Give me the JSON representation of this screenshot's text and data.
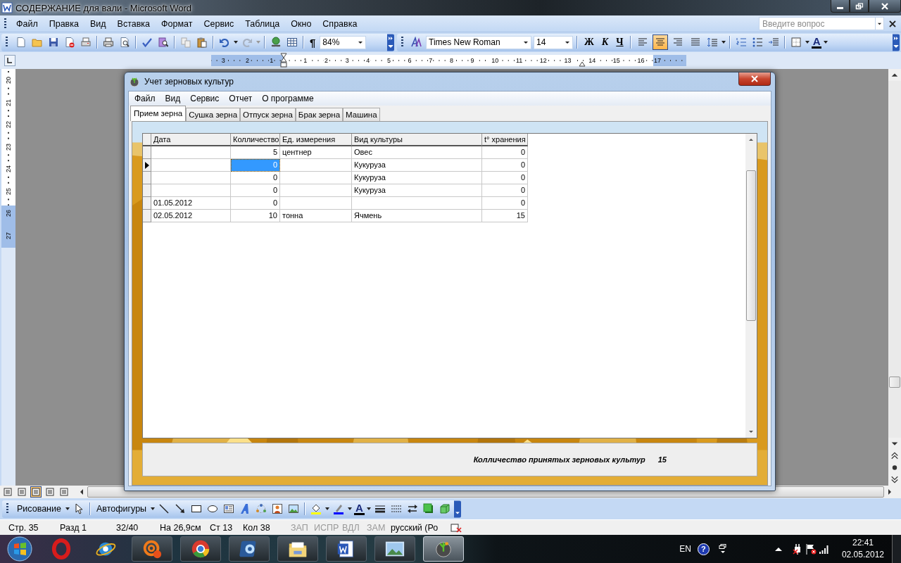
{
  "window": {
    "title": "СОДЕРЖАНИЕ для вали - Microsoft Word"
  },
  "menu": [
    "Файл",
    "Правка",
    "Вид",
    "Вставка",
    "Формат",
    "Сервис",
    "Таблица",
    "Окно",
    "Справка"
  ],
  "help_box": {
    "placeholder": "Введите вопрос"
  },
  "toolbar": {
    "show_marks": "¶",
    "zoom": "84%",
    "font": "Times New Roman",
    "size": "14",
    "bold": "Ж",
    "italic": "К",
    "underline": "Ч",
    "alignment": [
      {
        "selected": false
      },
      {
        "selected": true
      },
      {
        "selected": false
      },
      {
        "selected": false
      }
    ],
    "font_color": "A"
  },
  "ruler": {
    "left_labels": [
      "3",
      "2",
      "1"
    ],
    "labels": [
      "1",
      "2",
      "3",
      "4",
      "5",
      "6",
      "7",
      "8",
      "9",
      "10",
      "11",
      "12",
      "13",
      "14",
      "15",
      "16"
    ],
    "right_labels": [
      "17"
    ]
  },
  "vertical_ruler": [
    "20",
    "21",
    "22",
    "23",
    "24",
    "25",
    "26",
    "27"
  ],
  "dialog": {
    "title": "Учет зерновых культур",
    "menu": [
      "Файл",
      "Вид",
      "Сервис",
      "Отчет",
      "О программе"
    ],
    "tabs": [
      {
        "label": "Прием зерна",
        "selected": true
      },
      {
        "label": "Сушка зерна",
        "selected": false
      },
      {
        "label": "Отпуск зерна",
        "selected": false
      },
      {
        "label": "Брак зерна",
        "selected": false
      },
      {
        "label": "Машина",
        "selected": false
      }
    ],
    "grid": {
      "columns": [
        "Дата",
        "Колличество",
        "Ед. измерения",
        "Вид культуры",
        "t° хранения"
      ],
      "rows": [
        {
          "selected": false,
          "cells": [
            "",
            "5",
            "центнер",
            "Овес",
            "0"
          ]
        },
        {
          "selected": true,
          "cells": [
            "",
            "0",
            "",
            "Кукуруза",
            "0"
          ]
        },
        {
          "selected": false,
          "cells": [
            "",
            "0",
            "",
            "Кукуруза",
            "0"
          ]
        },
        {
          "selected": false,
          "cells": [
            "",
            "0",
            "",
            "Кукуруза",
            "0"
          ]
        },
        {
          "selected": false,
          "cells": [
            "01.05.2012",
            "0",
            "",
            "",
            "0"
          ]
        },
        {
          "selected": false,
          "cells": [
            "02.05.2012",
            "10",
            "тонна",
            "Ячмень",
            "15"
          ]
        }
      ]
    },
    "footer": {
      "label": "Колличество принятых зерновых культур",
      "value": "15"
    }
  },
  "drawing_toolbar": {
    "draw": "Рисование",
    "autoshapes": "Автофигуры",
    "font_color": "A"
  },
  "status_bar": [
    {
      "text": "Стр. 35",
      "disabled": false
    },
    {
      "text": "Разд 1",
      "disabled": false
    },
    {
      "text": "32/40",
      "disabled": false
    },
    {
      "text": "На 26,9см",
      "disabled": false
    },
    {
      "text": "Ст 13",
      "disabled": false
    },
    {
      "text": "Кол 38",
      "disabled": false
    },
    {
      "text": "ЗАП",
      "disabled": true
    },
    {
      "text": "ИСПР",
      "disabled": true
    },
    {
      "text": "ВДЛ",
      "disabled": true
    },
    {
      "text": "ЗАМ",
      "disabled": true
    },
    {
      "text": "русский (Ро",
      "disabled": false
    }
  ],
  "taskbar": {
    "apps": [
      {
        "selected": false
      },
      {
        "selected": false
      },
      {
        "selected": false
      },
      {
        "selected": false
      },
      {
        "selected": false
      },
      {
        "selected": false
      },
      {
        "selected": false
      },
      {
        "selected": false
      },
      {
        "selected": true
      }
    ]
  },
  "tray": {
    "language": "EN",
    "help": "?",
    "time": "22:41",
    "date": "02.05.2012"
  }
}
